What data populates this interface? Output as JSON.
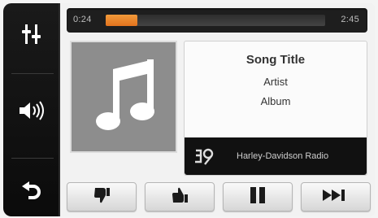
{
  "player": {
    "elapsed": "0:24",
    "duration": "2:45",
    "progress_fraction": 0.145,
    "accent_color": "#e8802a"
  },
  "track": {
    "title": "Song Title",
    "artist": "Artist",
    "album": "Album"
  },
  "source": {
    "label": "Harley-Davidson Radio",
    "icon": "radio-source-icon"
  },
  "sidebar": {
    "items": [
      {
        "icon": "eq-settings-icon"
      },
      {
        "icon": "volume-icon"
      },
      {
        "icon": "back-arrow-icon"
      }
    ]
  },
  "controls": [
    {
      "icon": "thumbs-down-icon"
    },
    {
      "icon": "thumbs-up-icon"
    },
    {
      "icon": "pause-icon"
    },
    {
      "icon": "skip-forward-icon"
    }
  ]
}
